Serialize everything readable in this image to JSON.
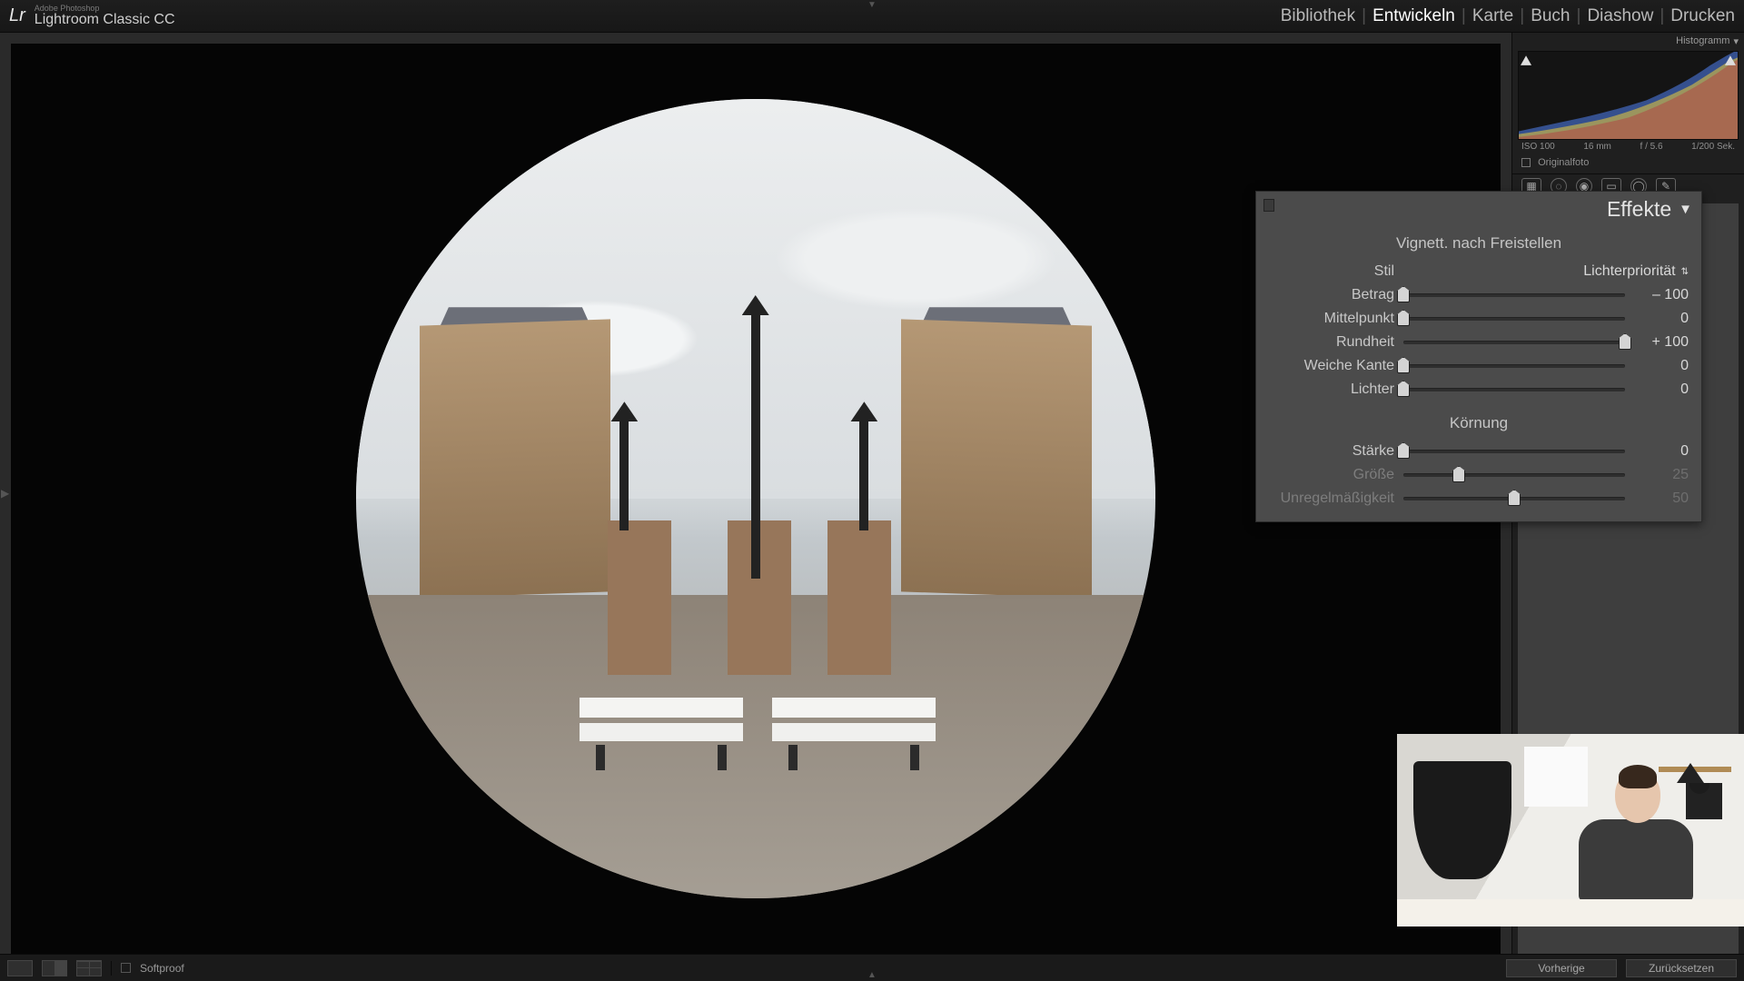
{
  "brand": {
    "sub": "Adobe Photoshop",
    "main": "Lightroom Classic CC"
  },
  "modules": {
    "items": [
      "Bibliothek",
      "Entwickeln",
      "Karte",
      "Buch",
      "Diashow",
      "Drucken"
    ],
    "active_index": 1
  },
  "histogram": {
    "title": "Histogramm",
    "meta": {
      "iso": "ISO 100",
      "focal": "16 mm",
      "aperture": "f / 5.6",
      "shutter": "1/200 Sek."
    },
    "original_label": "Originalfoto"
  },
  "toolstrip_icons": [
    "crop",
    "spot",
    "eye",
    "grad",
    "radial",
    "brush"
  ],
  "effects_panel": {
    "title": "Effekte",
    "vignette": {
      "heading": "Vignett. nach Freistellen",
      "style_label": "Stil",
      "style_value": "Lichterpriorität",
      "sliders": [
        {
          "label": "Betrag",
          "value": "– 100",
          "pos": 0
        },
        {
          "label": "Mittelpunkt",
          "value": "0",
          "pos": 0
        },
        {
          "label": "Rundheit",
          "value": "+ 100",
          "pos": 100
        },
        {
          "label": "Weiche Kante",
          "value": "0",
          "pos": 0
        },
        {
          "label": "Lichter",
          "value": "0",
          "pos": 0
        }
      ]
    },
    "grain": {
      "heading": "Körnung",
      "sliders": [
        {
          "label": "Stärke",
          "value": "0",
          "pos": 0,
          "enabled": true
        },
        {
          "label": "Größe",
          "value": "25",
          "pos": 25,
          "enabled": false
        },
        {
          "label": "Unregelmäßigkeit",
          "value": "50",
          "pos": 50,
          "enabled": false
        }
      ]
    }
  },
  "bottombar": {
    "softproof": "Softproof",
    "buttons": {
      "previous": "Vorherige",
      "reset": "Zurücksetzen"
    }
  }
}
